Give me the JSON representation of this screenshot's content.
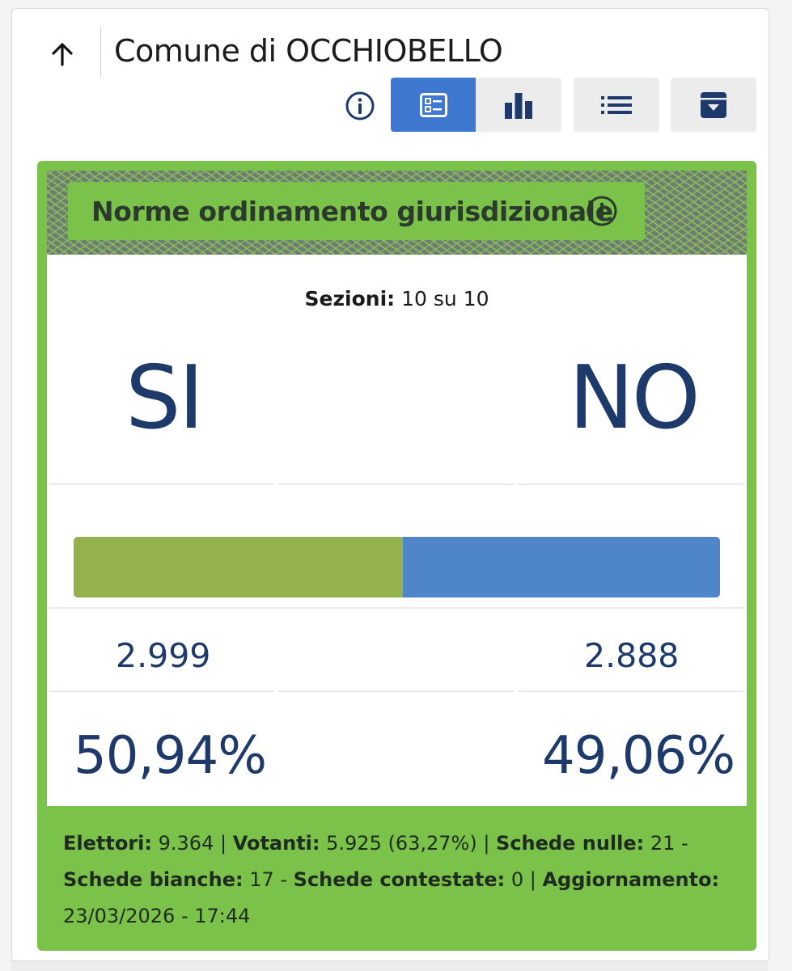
{
  "header": {
    "title": "Comune di OCCHIOBELLO"
  },
  "toolbar": {
    "info_icon": "info-icon",
    "views": [
      {
        "name": "card-view",
        "icon": "card-icon",
        "active": true
      },
      {
        "name": "chart-view",
        "icon": "bar-chart-icon",
        "active": false
      },
      {
        "name": "list-view",
        "icon": "list-icon",
        "active": false
      },
      {
        "name": "archive",
        "icon": "archive-icon",
        "active": false
      }
    ]
  },
  "referendum": {
    "title": "Norme ordinamento giurisdizionale",
    "sezioni_label": "Sezioni:",
    "sezioni_value": "10 su 10",
    "si_label": "SI",
    "no_label": "NO",
    "si_votes": "2.999",
    "no_votes": "2.888",
    "si_pct": "50,94%",
    "no_pct": "49,06%",
    "si_share": 0.5094,
    "colors": {
      "si": "#93b24e",
      "no": "#4f86c9",
      "panel": "#7bc24a",
      "accent": "#3f78d0",
      "text": "#1d3a6b"
    }
  },
  "footer": {
    "elettori_label": "Elettori:",
    "elettori_value": " 9.364 | ",
    "votanti_label": "Votanti:",
    "votanti_value": " 5.925 (63,27%) | ",
    "nulle_label": "Schede nulle:",
    "nulle_value": " 21 - ",
    "bianche_label": "Schede bianche:",
    "bianche_value": " 17 - ",
    "contestate_label": "Schede contestate:",
    "contestate_value": " 0 | ",
    "aggiornamento_label": "Aggiornamento:",
    "aggiornamento_value": " 23/03/2026 - 17:44"
  }
}
